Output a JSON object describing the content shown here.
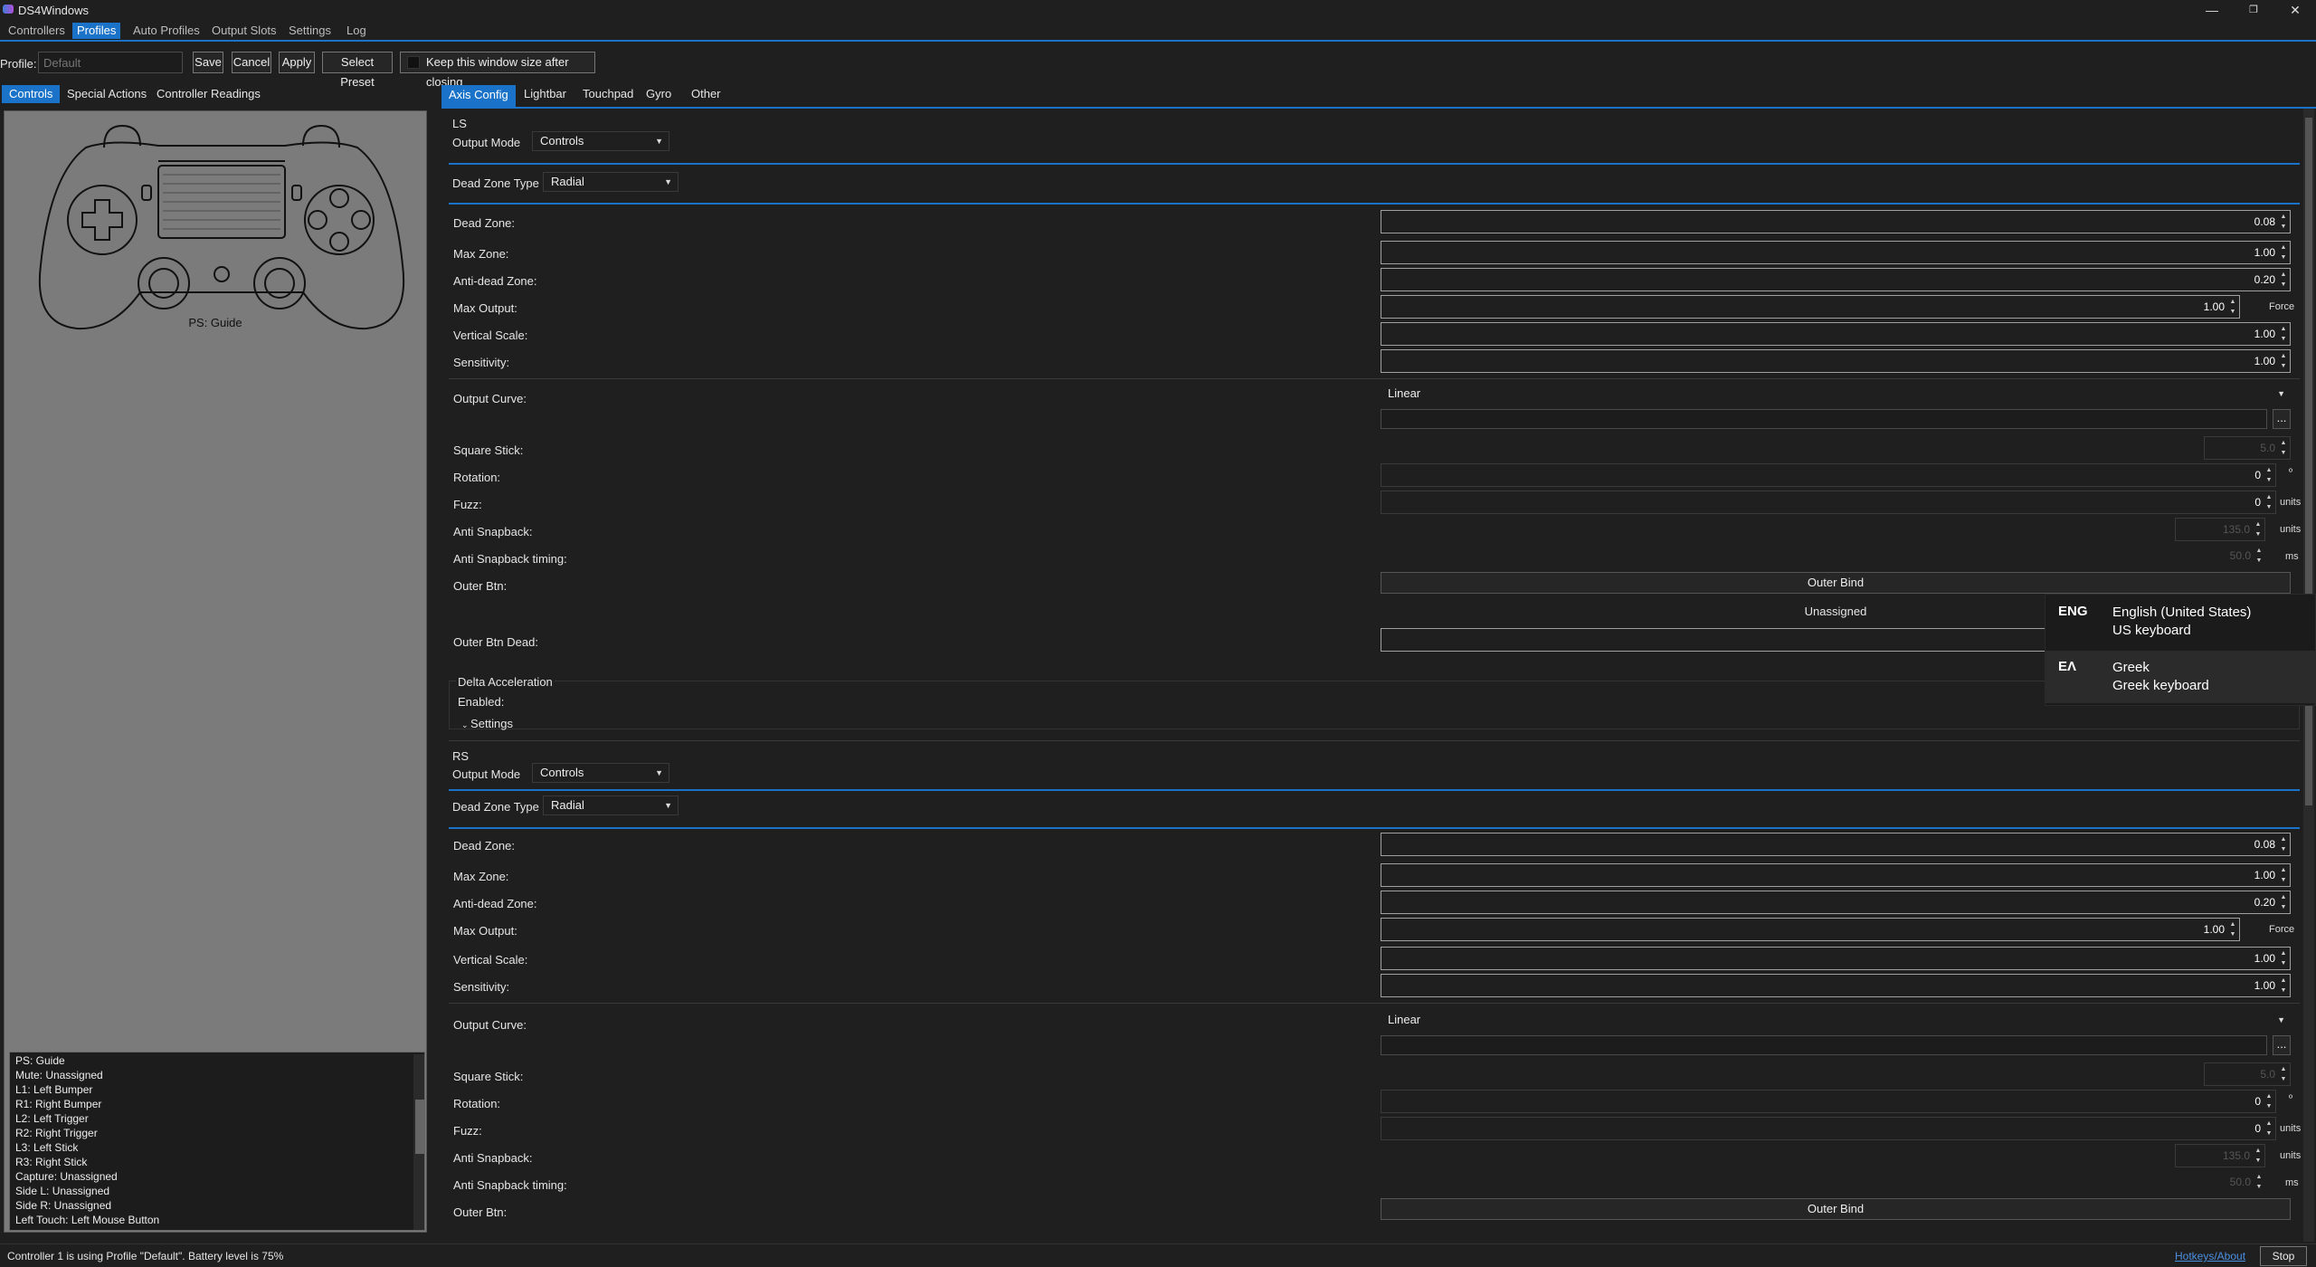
{
  "window": {
    "title": "DS4Windows",
    "minimize": "—",
    "restore": "❐",
    "close": "✕"
  },
  "menu": [
    "Controllers",
    "Profiles",
    "Auto Profiles",
    "Output Slots",
    "Settings",
    "Log"
  ],
  "profile_bar": {
    "label": "Profile:",
    "placeholder": "Default",
    "save": "Save",
    "cancel": "Cancel",
    "apply": "Apply",
    "select_preset": "Select Preset",
    "keep_size": "Keep this window size after closing"
  },
  "left_tabs": [
    "Controls",
    "Special Actions",
    "Controller Readings"
  ],
  "right_tabs": [
    "Axis Config",
    "Lightbar",
    "Touchpad",
    "Gyro",
    "Other"
  ],
  "controller": {
    "hover_label": "PS: Guide"
  },
  "bindings": [
    "PS: Guide",
    "Mute: Unassigned",
    "L1: Left Bumper",
    "R1: Right Bumper",
    "L2: Left Trigger",
    "R2: Right Trigger",
    "L3: Left Stick",
    "R3: Right Stick",
    "Capture: Unassigned",
    "Side L: Unassigned",
    "Side R: Unassigned",
    "Left Touch: Left Mouse Button"
  ],
  "labels": {
    "output_mode": "Output Mode",
    "dead_zone_type": "Dead Zone Type",
    "dead_zone": "Dead Zone:",
    "max_zone": "Max Zone:",
    "anti_dead_zone": "Anti-dead Zone:",
    "max_output": "Max Output:",
    "vertical_scale": "Vertical Scale:",
    "sensitivity": "Sensitivity:",
    "output_curve": "Output Curve:",
    "square_stick": "Square Stick:",
    "rotation": "Rotation:",
    "fuzz": "Fuzz:",
    "anti_snapback": "Anti Snapback:",
    "anti_snapback_timing": "Anti Snapback timing:",
    "outer_btn": "Outer Btn:",
    "outer_btn_dead": "Outer Btn Dead:",
    "force": "Force",
    "units": "units",
    "ms": "ms",
    "degree": "º",
    "ellipsis": "...",
    "outer_bind": "Outer Bind",
    "unassigned": "Unassigned",
    "delta_acceleration": "Delta Acceleration",
    "enabled": "Enabled:",
    "settings": "Settings"
  },
  "ls": {
    "title": "LS",
    "output_mode": "Controls",
    "dead_zone_type": "Radial",
    "dead_zone": "0.08",
    "max_zone": "1.00",
    "anti_dead_zone": "0.20",
    "max_output": "1.00",
    "vertical_scale": "1.00",
    "sensitivity": "1.00",
    "output_curve": "Linear",
    "square_stick": "5.0",
    "rotation": "0",
    "fuzz": "0",
    "anti_snapback": "135.0",
    "anti_snapback_timing": "50.0"
  },
  "rs": {
    "title": "RS",
    "output_mode": "Controls",
    "dead_zone_type": "Radial",
    "dead_zone": "0.08",
    "max_zone": "1.00",
    "anti_dead_zone": "0.20",
    "max_output": "1.00",
    "vertical_scale": "1.00",
    "sensitivity": "1.00",
    "output_curve": "Linear",
    "square_stick": "5.0",
    "rotation": "0",
    "fuzz": "0",
    "anti_snapback": "135.0",
    "anti_snapback_timing": "50.0"
  },
  "status": {
    "text": "Controller 1 is using Profile \"Default\". Battery level is 75%",
    "hotkeys": "Hotkeys/About",
    "stop": "Stop"
  },
  "language_popup": [
    {
      "code": "ENG",
      "name": "English (United States)",
      "keyboard": "US keyboard"
    },
    {
      "code": "ΕΛ",
      "name": "Greek",
      "keyboard": "Greek keyboard"
    }
  ],
  "colors": {
    "accent": "#1a73c8",
    "background": "#1f1f1f"
  }
}
